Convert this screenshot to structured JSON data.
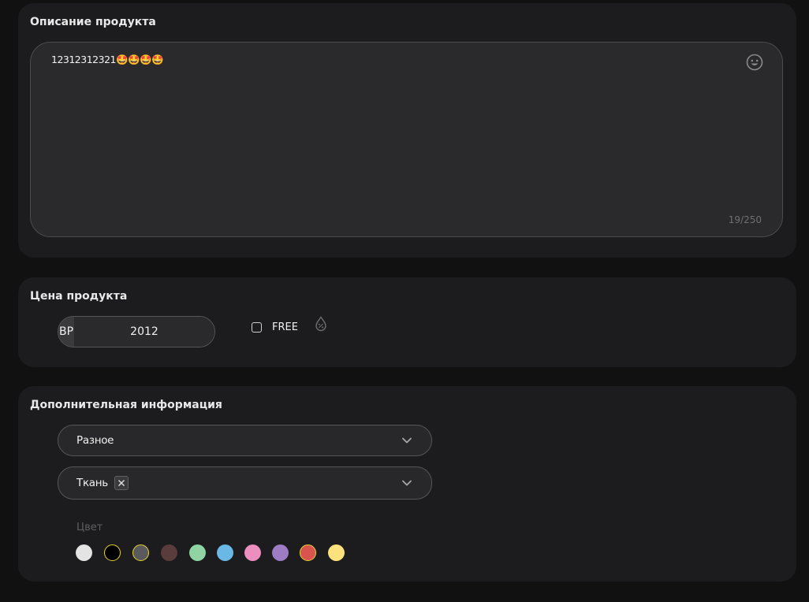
{
  "description": {
    "title": "Описание продукта",
    "value": "12312312321🤩🤩🤩🤩",
    "counter": "19/250",
    "emoji_icon": "smiley-face-icon"
  },
  "price": {
    "title": "Цена продукта",
    "currency": "BP",
    "amount": "2012",
    "free_label": "FREE",
    "free_checked": false,
    "discount_icon": "discount-drop-icon"
  },
  "extra": {
    "title": "Дополнительная информация",
    "category": "Разное",
    "material_tag": "Ткань",
    "color_label": "Цвет",
    "colors": [
      {
        "hex": "#e4e4e4",
        "selected": false
      },
      {
        "hex": "#000000",
        "selected": true
      },
      {
        "hex": "#5a5a5c",
        "selected": true
      },
      {
        "hex": "#5a3c3c",
        "selected": false
      },
      {
        "hex": "#8fd4a2",
        "selected": false
      },
      {
        "hex": "#6ab8e6",
        "selected": false
      },
      {
        "hex": "#ec8fbf",
        "selected": false
      },
      {
        "hex": "#9e7cc4",
        "selected": false
      },
      {
        "hex": "#d9534f",
        "selected": true
      },
      {
        "hex": "#fbe27c",
        "selected": false
      }
    ]
  }
}
